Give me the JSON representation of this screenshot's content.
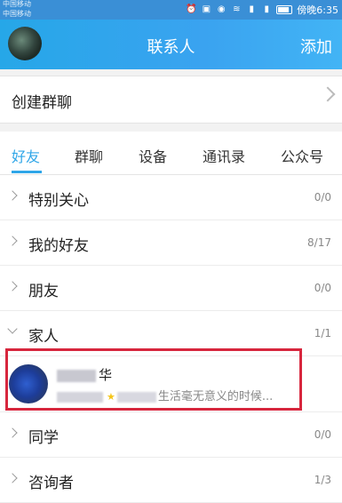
{
  "status_bar": {
    "carrier_1": "中国移动",
    "carrier_2": "中国移动",
    "time": "傍晚6:35"
  },
  "header": {
    "title": "联系人",
    "add_label": "添加"
  },
  "group_chat": {
    "label": "创建群聊"
  },
  "tabs": [
    {
      "label": "好友",
      "active": true
    },
    {
      "label": "群聊",
      "active": false
    },
    {
      "label": "设备",
      "active": false
    },
    {
      "label": "通讯录",
      "active": false
    },
    {
      "label": "公众号",
      "active": false
    }
  ],
  "groups": [
    {
      "name": "特别关心",
      "count": "0/0"
    },
    {
      "name": "我的好友",
      "count": "8/17"
    },
    {
      "name": "朋友",
      "count": "0/0"
    },
    {
      "name": "家人",
      "count": "1/1"
    },
    {
      "name": "同学",
      "count": "0/0"
    },
    {
      "name": "咨询者",
      "count": "1/3"
    }
  ],
  "contact": {
    "name_suffix": "华",
    "signature": "生活毫无意义的时候..."
  },
  "colors": {
    "accent": "#2fa6e8",
    "highlight": "#d7263d"
  }
}
